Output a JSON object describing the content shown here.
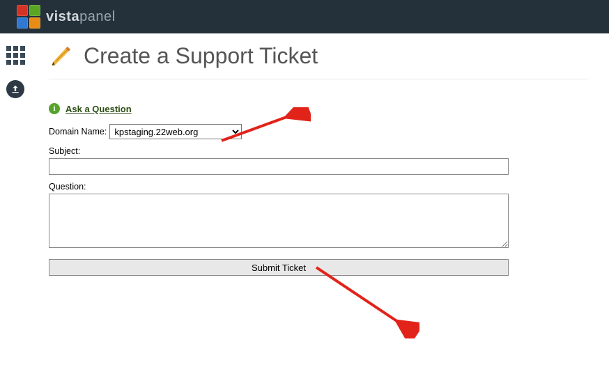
{
  "brand": {
    "name_strong": "vista",
    "name_light": "panel"
  },
  "page": {
    "title": "Create a Support Ticket"
  },
  "ask": {
    "label": "Ask a Question"
  },
  "form": {
    "domain_label": "Domain Name:",
    "domain_value": "kpstaging.22web.org",
    "subject_label": "Subject:",
    "subject_value": "",
    "question_label": "Question:",
    "question_value": "",
    "submit_label": "Submit Ticket"
  }
}
